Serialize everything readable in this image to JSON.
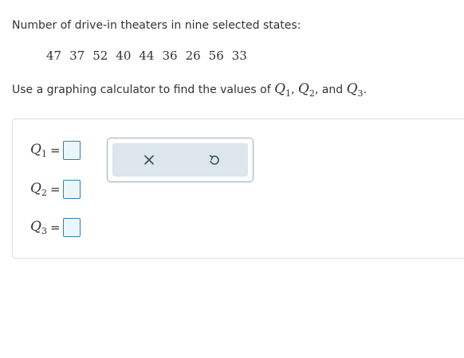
{
  "question": {
    "prompt": "Number of drive-in theaters in nine selected states:",
    "values": [
      "47",
      "37",
      "52",
      "40",
      "44",
      "36",
      "26",
      "56",
      "33"
    ],
    "instruction_prefix": "Use a graphing calculator to find the values of",
    "instruction_and": "and",
    "q_symbol": "Q",
    "q_subscripts": [
      "1",
      "2",
      "3"
    ],
    "sep_comma": ",",
    "end_period": "."
  },
  "answers": {
    "rows": [
      {
        "symbol": "Q",
        "sub": "1",
        "eq": "=",
        "value": ""
      },
      {
        "symbol": "Q",
        "sub": "2",
        "eq": "=",
        "value": ""
      },
      {
        "symbol": "Q",
        "sub": "3",
        "eq": "=",
        "value": ""
      }
    ]
  },
  "toolbar": {
    "clear_icon": "close-icon",
    "undo_icon": "undo-icon"
  },
  "colors": {
    "answer_border": "#3a7ca5",
    "answer_fill": "#eaf6fb",
    "toolbar_fill": "#dde6ea",
    "icon_color": "#2f4f5f"
  }
}
